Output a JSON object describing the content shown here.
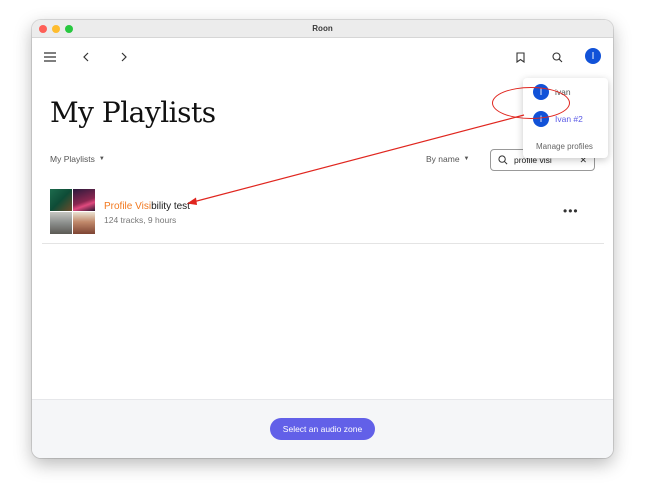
{
  "window": {
    "title": "Roon"
  },
  "toolbar": {
    "menu_icon": "hamburger-icon",
    "back_icon": "chevron-left-icon",
    "forward_icon": "chevron-right-icon",
    "bookmark_icon": "bookmark-icon",
    "search_icon": "search-icon",
    "profile_initial": "I"
  },
  "page": {
    "title": "My Playlists",
    "filter_label": "My Playlists",
    "sort_label": "By name",
    "search": {
      "value": "profile visi",
      "placeholder": ""
    }
  },
  "playlists": [
    {
      "title_highlight": "Profile Visi",
      "title_rest": "bility test",
      "subtitle": "124 tracks, 9 hours"
    }
  ],
  "profile_menu": {
    "items": [
      {
        "initial": "I",
        "label": "ivan"
      },
      {
        "initial": "I",
        "label": "Ivan #2"
      }
    ],
    "manage_label": "Manage profiles"
  },
  "footer": {
    "zone_button_label": "Select an audio zone"
  },
  "colors": {
    "accent": "#6260e8",
    "highlight": "#f2791f",
    "avatar": "#1152d8",
    "annotation": "#e0261f"
  }
}
